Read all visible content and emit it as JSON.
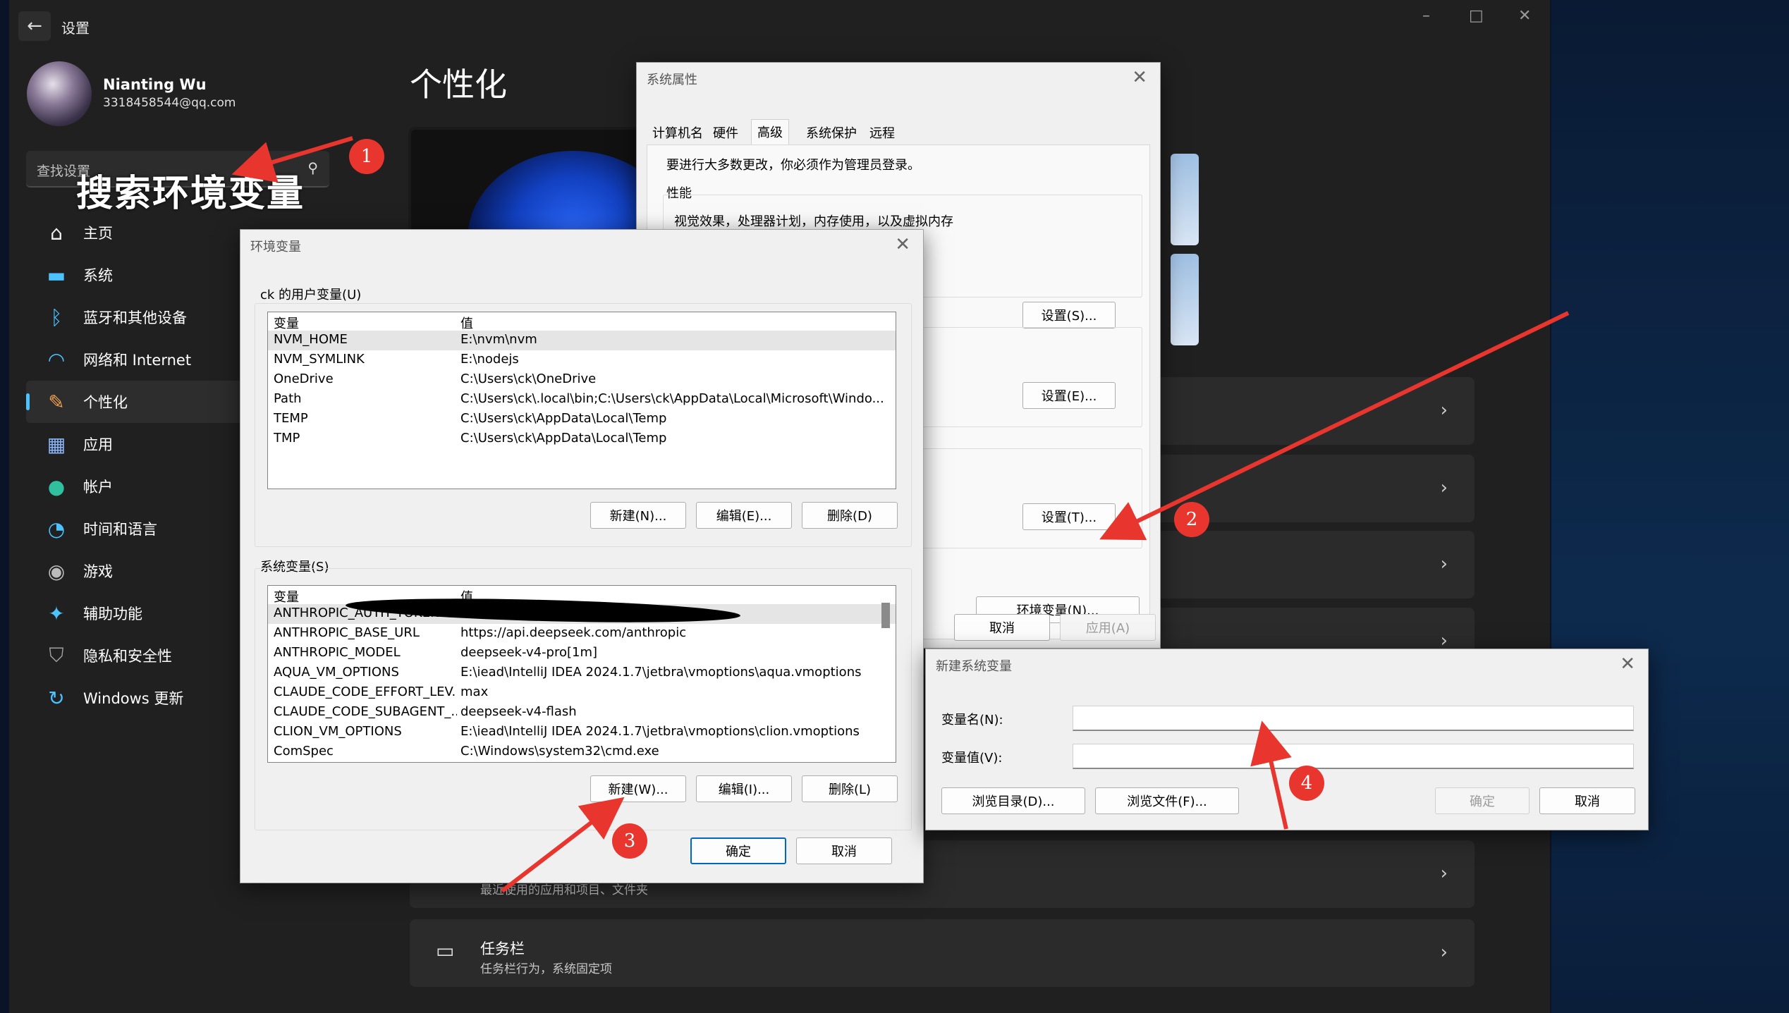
{
  "app": {
    "title": "设置",
    "back_icon": "arrow-left-icon"
  },
  "user": {
    "name": "Nianting Wu",
    "email": "3318458544@qq.com"
  },
  "search": {
    "placeholder": "查找设置"
  },
  "annotation_text": "搜索环境变量",
  "nav": [
    {
      "label": "主页",
      "icon": "home-icon",
      "color": "#f0f0f0"
    },
    {
      "label": "系统",
      "icon": "monitor-icon",
      "color": "#4cc2ff"
    },
    {
      "label": "蓝牙和其他设备",
      "icon": "bluetooth-icon",
      "color": "#4cc2ff"
    },
    {
      "label": "网络和 Internet",
      "icon": "wifi-icon",
      "color": "#4cc2ff"
    },
    {
      "label": "个性化",
      "icon": "brush-icon",
      "color": "#f0a050",
      "active": true
    },
    {
      "label": "应用",
      "icon": "apps-icon",
      "color": "#8ab4f8"
    },
    {
      "label": "帐户",
      "icon": "person-icon",
      "color": "#30c0a0"
    },
    {
      "label": "时间和语言",
      "icon": "globe-clock-icon",
      "color": "#4cc2ff"
    },
    {
      "label": "游戏",
      "icon": "gamepad-icon",
      "color": "#bbbbbb"
    },
    {
      "label": "辅助功能",
      "icon": "accessibility-icon",
      "color": "#4cc2ff"
    },
    {
      "label": "隐私和安全性",
      "icon": "shield-icon",
      "color": "#a0a0a0"
    },
    {
      "label": "Windows 更新",
      "icon": "sync-icon",
      "color": "#4cc2ff"
    }
  ],
  "page_title": "个性化",
  "cards": [
    {
      "title": "",
      "subtitle": ""
    },
    {
      "title": "",
      "subtitle": ""
    },
    {
      "title": "",
      "subtitle": ""
    },
    {
      "title": "",
      "subtitle": ""
    },
    {
      "title": "",
      "subtitle": "最近使用的应用和项目、文件夹"
    },
    {
      "title": "任务栏",
      "subtitle": "任务栏行为，系统固定项",
      "icon": "taskbar-icon"
    }
  ],
  "sysprops": {
    "title": "系统属性",
    "tabs": [
      "计算机名",
      "硬件",
      "高级",
      "系统保护",
      "远程"
    ],
    "active_tab": "高级",
    "admin_note": "要进行大多数更改，你必须作为管理员登录。",
    "perf_label": "性能",
    "perf_desc": "视觉效果，处理器计划，内存使用，以及虚拟内存",
    "btn_settings_s": "设置(S)...",
    "btn_settings_e": "设置(E)...",
    "btn_settings_t": "设置(T)...",
    "btn_env": "环境变量(N)...",
    "btn_cancel": "取消",
    "btn_apply": "应用(A)"
  },
  "envvars": {
    "title": "环境变量",
    "user_label": "ck 的用户变量(U)",
    "col_var": "变量",
    "col_val": "值",
    "user_rows": [
      {
        "name": "NVM_HOME",
        "value": "E:\\nvm\\nvm"
      },
      {
        "name": "NVM_SYMLINK",
        "value": "E:\\nodejs"
      },
      {
        "name": "OneDrive",
        "value": "C:\\Users\\ck\\OneDrive"
      },
      {
        "name": "Path",
        "value": "C:\\Users\\ck\\.local\\bin;C:\\Users\\ck\\AppData\\Local\\Microsoft\\Windo..."
      },
      {
        "name": "TEMP",
        "value": "C:\\Users\\ck\\AppData\\Local\\Temp"
      },
      {
        "name": "TMP",
        "value": "C:\\Users\\ck\\AppData\\Local\\Temp"
      }
    ],
    "btn_user_new": "新建(N)...",
    "btn_user_edit": "编辑(E)...",
    "btn_user_delete": "删除(D)",
    "sys_label": "系统变量(S)",
    "sys_rows": [
      {
        "name": "ANTHROPIC_AUTH_TOKEN",
        "value": ""
      },
      {
        "name": "ANTHROPIC_BASE_URL",
        "value": "https://api.deepseek.com/anthropic"
      },
      {
        "name": "ANTHROPIC_MODEL",
        "value": "deepseek-v4-pro[1m]"
      },
      {
        "name": "AQUA_VM_OPTIONS",
        "value": "E:\\iead\\IntelliJ IDEA 2024.1.7\\jetbra\\vmoptions\\aqua.vmoptions"
      },
      {
        "name": "CLAUDE_CODE_EFFORT_LEV...",
        "value": "max"
      },
      {
        "name": "CLAUDE_CODE_SUBAGENT_...",
        "value": "deepseek-v4-flash"
      },
      {
        "name": "CLION_VM_OPTIONS",
        "value": "E:\\iead\\IntelliJ IDEA 2024.1.7\\jetbra\\vmoptions\\clion.vmoptions"
      },
      {
        "name": "ComSpec",
        "value": "C:\\Windows\\system32\\cmd.exe"
      }
    ],
    "btn_sys_new": "新建(W)...",
    "btn_sys_edit": "编辑(I)...",
    "btn_sys_delete": "删除(L)",
    "btn_ok": "确定",
    "btn_cancel": "取消"
  },
  "newvar": {
    "title": "新建系统变量",
    "name_label": "变量名(N):",
    "value_label": "变量值(V):",
    "name_value": "",
    "value_value": "",
    "btn_browse_dir": "浏览目录(D)...",
    "btn_browse_file": "浏览文件(F)...",
    "btn_ok": "确定",
    "btn_cancel": "取消"
  },
  "step_markers": [
    "1",
    "2",
    "3",
    "4"
  ],
  "colors": {
    "accent": "#4cc2ff",
    "annotation": "#e8352e",
    "dialog_bg": "#f0f0f0"
  }
}
